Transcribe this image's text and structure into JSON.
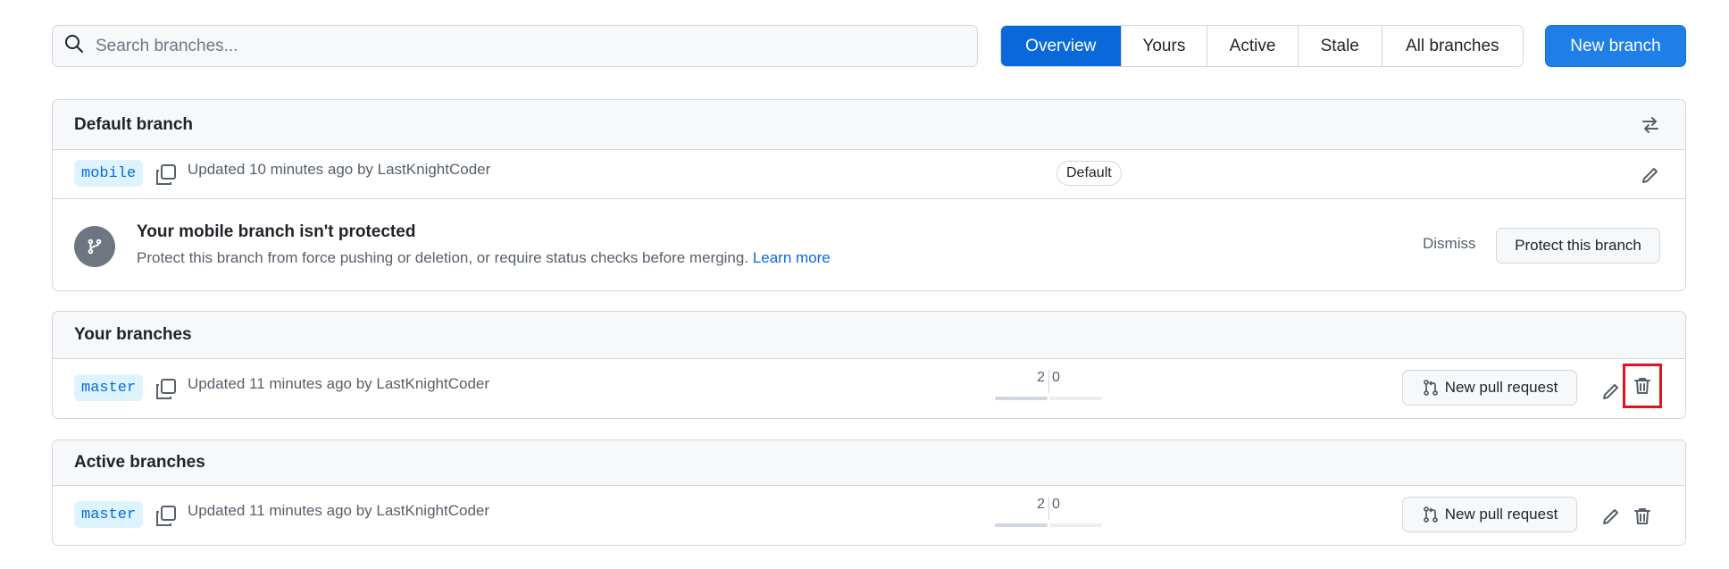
{
  "search": {
    "placeholder": "Search branches..."
  },
  "tabs": [
    {
      "label": "Overview",
      "active": true
    },
    {
      "label": "Yours",
      "active": false
    },
    {
      "label": "Active",
      "active": false
    },
    {
      "label": "Stale",
      "active": false
    },
    {
      "label": "All branches",
      "active": false
    }
  ],
  "new_branch_label": "New branch",
  "default_section": {
    "title": "Default branch",
    "branch": "mobile",
    "updated": "Updated 10 minutes ago by LastKnightCoder",
    "badge": "Default",
    "protection": {
      "title": "Your mobile branch isn't protected",
      "description": "Protect this branch from force pushing or deletion, or require status checks before merging.",
      "learn_more": "Learn more",
      "dismiss": "Dismiss",
      "protect_button": "Protect this branch"
    }
  },
  "your_section": {
    "title": "Your branches",
    "branch": "master",
    "updated": "Updated 11 minutes ago by LastKnightCoder",
    "behind": "2",
    "ahead": "0",
    "pr_button": "New pull request"
  },
  "active_section": {
    "title": "Active branches",
    "branch": "master",
    "updated": "Updated 11 minutes ago by LastKnightCoder",
    "behind": "2",
    "ahead": "0",
    "pr_button": "New pull request"
  },
  "colors": {
    "accent": "#0969da",
    "primary_button": "#1f7fe8",
    "branch_tag_bg": "#ddf4ff",
    "highlight": "#e0141c"
  }
}
